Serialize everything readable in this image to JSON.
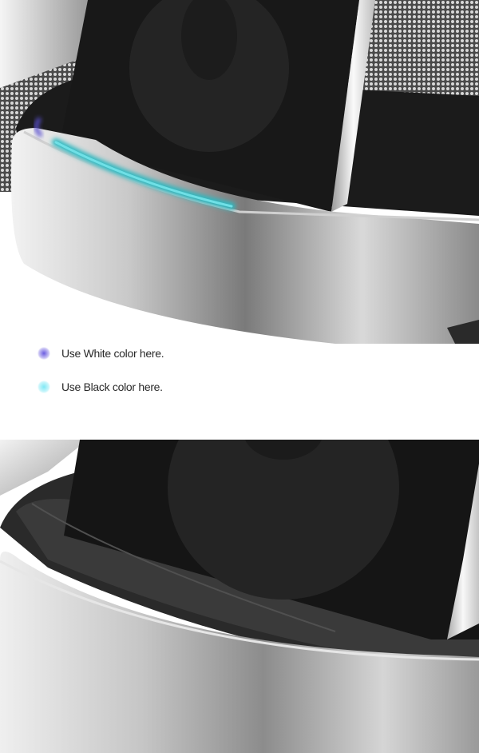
{
  "legend": {
    "items": [
      {
        "label": "Use White color here.",
        "marker_color": "#6b5ce0"
      },
      {
        "label": "Use Black color here.",
        "marker_color": "#7fe8f5"
      }
    ]
  },
  "colors": {
    "speaker_grille": "#5a5a5a",
    "device_body": "#1a1a1a",
    "dock_ring": "#b8b8b8",
    "highlight_white_marker": "#5a4fd0",
    "highlight_black_marker": "#2fb8c0"
  }
}
